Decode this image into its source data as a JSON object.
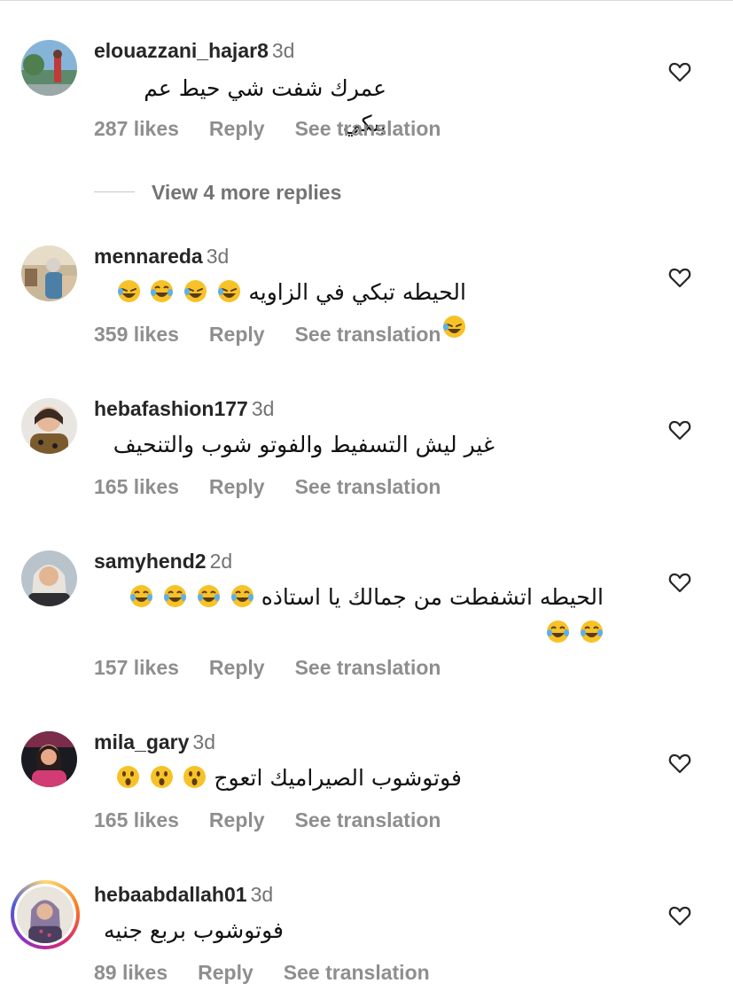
{
  "comments": [
    {
      "username": "elouazzani_hajar8",
      "time": "3d",
      "text": "عمرك شفت شي حيط عم يبكي",
      "likes": "287 likes",
      "reply_label": "Reply",
      "translate_label": "See translation"
    },
    {
      "username": "mennareda",
      "time": "3d",
      "text": "الحيطه تبكي في الزاويه",
      "emojis": [
        "rofl-emoji",
        "rofl-emoji",
        "joy-emoji",
        "rofl-emoji",
        "rofl-emoji"
      ],
      "likes": "359 likes",
      "reply_label": "Reply",
      "translate_label": "See translation"
    },
    {
      "username": "hebafashion177",
      "time": "3d",
      "text": "غير ليش التسفيط والفوتو شوب والتنحيف",
      "likes": "165 likes",
      "reply_label": "Reply",
      "translate_label": "See translation"
    },
    {
      "username": "samyhend2",
      "time": "2d",
      "text": "الحيطه اتشفطت من جمالك يا استاذه",
      "emojis": [
        "joy-emoji",
        "joy-emoji",
        "joy-emoji",
        "joy-emoji",
        "joy-emoji",
        "joy-emoji"
      ],
      "likes": "157 likes",
      "reply_label": "Reply",
      "translate_label": "See translation"
    },
    {
      "username": "mila_gary",
      "time": "3d",
      "text": "فوتوشوب الصيراميك اتعوج",
      "emojis": [
        "astonished-emoji",
        "astonished-emoji",
        "astonished-emoji"
      ],
      "likes": "165 likes",
      "reply_label": "Reply",
      "translate_label": "See translation"
    },
    {
      "username": "hebaabdallah01",
      "time": "3d",
      "text": "فوتوشوب بربع جنيه",
      "likes": "89 likes",
      "reply_label": "Reply",
      "translate_label": "See translation"
    }
  ],
  "view_more_replies": "View 4 more replies",
  "icons": {
    "like": "heart-outline-icon"
  },
  "colors": {
    "text": "#262626",
    "secondary": "#8e8e8e",
    "story_ring": [
      "#feda75",
      "#fa7e1e",
      "#d62976",
      "#962fbf"
    ]
  }
}
